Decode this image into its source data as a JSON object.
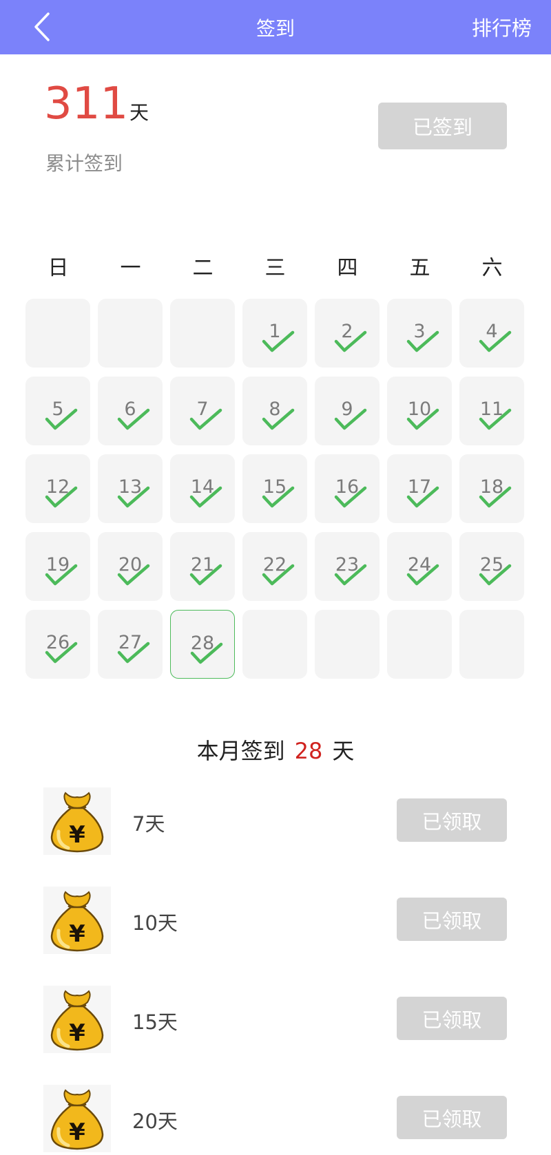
{
  "header": {
    "title": "签到",
    "rank_label": "排行榜"
  },
  "summary": {
    "total_days": "311",
    "unit": "天",
    "label": "累计签到",
    "signed_button": "已签到"
  },
  "calendar": {
    "weekdays": [
      "日",
      "一",
      "二",
      "三",
      "四",
      "五",
      "六"
    ],
    "leading_blanks": 3,
    "days_in_month": 28,
    "signed_days": [
      1,
      2,
      3,
      4,
      5,
      6,
      7,
      8,
      9,
      10,
      11,
      12,
      13,
      14,
      15,
      16,
      17,
      18,
      19,
      20,
      21,
      22,
      23,
      24,
      25,
      26,
      27,
      28
    ],
    "today": 28,
    "check_color": "#4cba5a"
  },
  "month_summary": {
    "prefix": "本月签到",
    "count": "28",
    "suffix": "天"
  },
  "rewards": [
    {
      "label": "7天",
      "button": "已领取"
    },
    {
      "label": "10天",
      "button": "已领取"
    },
    {
      "label": "15天",
      "button": "已领取"
    },
    {
      "label": "20天",
      "button": "已领取"
    }
  ],
  "colors": {
    "header_bg": "#7b82fa",
    "accent_red": "#e04a43",
    "disabled_button": "#d4d4d4"
  }
}
